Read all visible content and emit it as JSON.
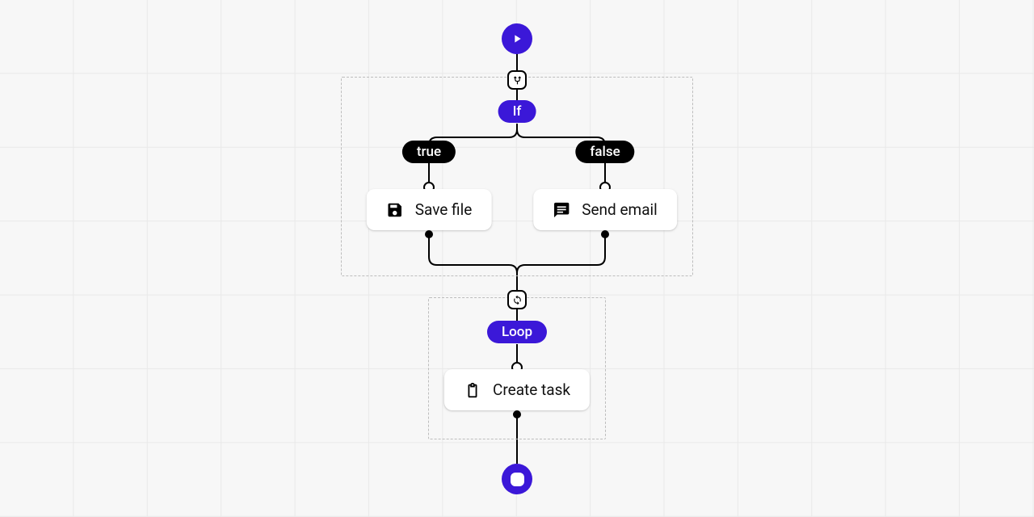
{
  "nodes": {
    "if_label": "If",
    "true_label": "true",
    "false_label": "false",
    "save_file": "Save file",
    "send_email": "Send email",
    "loop_label": "Loop",
    "create_task": "Create task"
  }
}
